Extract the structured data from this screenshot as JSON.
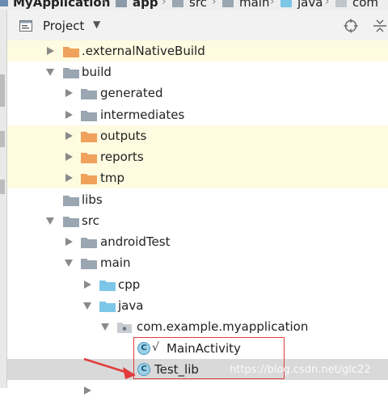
{
  "breadcrumb": {
    "project": "MyApplication",
    "module": "app",
    "items": [
      "src",
      "main",
      "java",
      "com"
    ]
  },
  "project_panel": {
    "view_label": "Project",
    "caret": "▼"
  },
  "tree": [
    {
      "label": ".externalNativeBuild",
      "icon": "orange-folder-icon",
      "expanded": false
    },
    {
      "label": "build",
      "icon": "gray-folder-icon",
      "expanded": true
    },
    {
      "label": "generated",
      "icon": "gray-folder-icon",
      "expanded": false
    },
    {
      "label": "intermediates",
      "icon": "gray-folder-icon",
      "expanded": false
    },
    {
      "label": "outputs",
      "icon": "orange-folder-icon",
      "expanded": false
    },
    {
      "label": "reports",
      "icon": "orange-folder-icon",
      "expanded": false
    },
    {
      "label": "tmp",
      "icon": "orange-folder-icon",
      "expanded": false
    },
    {
      "label": "libs",
      "icon": "gray-folder-icon"
    },
    {
      "label": "src",
      "icon": "gray-folder-icon",
      "expanded": true
    },
    {
      "label": "androidTest",
      "icon": "gray-folder-icon",
      "expanded": false
    },
    {
      "label": "main",
      "icon": "gray-folder-icon",
      "expanded": true
    },
    {
      "label": "cpp",
      "icon": "blue-folder-icon",
      "expanded": false
    },
    {
      "label": "java",
      "icon": "blue-folder-icon",
      "expanded": true
    },
    {
      "label": "com.example.myapplication",
      "icon": "package-icon",
      "expanded": true
    },
    {
      "label": "MainActivity",
      "icon": "class-icon",
      "class_letter": "C",
      "vcs_mark": "√"
    },
    {
      "label": "Test_lib",
      "icon": "class-icon",
      "class_letter": "C",
      "selected": true
    }
  ],
  "watermark": "https://blog.csdn.net/glc22",
  "colors": {
    "excluded_row": "#fffbe0",
    "selected_row": "#d9d9d9",
    "orange_folder": "#f0a25c",
    "gray_folder": "#9aa6b1",
    "blue_folder": "#7cc6e8",
    "highlight": "#e13b3b"
  }
}
